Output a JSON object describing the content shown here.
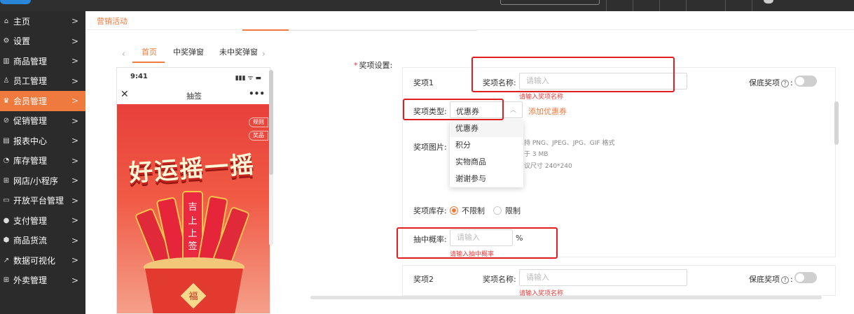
{
  "breadcrumb": "营销活动",
  "sidebar": {
    "items": [
      {
        "icon": "⌂",
        "icon_name": "home-icon",
        "label": "主页"
      },
      {
        "icon": "⚙",
        "icon_name": "settings-icon",
        "label": "设置"
      },
      {
        "icon": "▥",
        "icon_name": "barcode-icon",
        "label": "商品管理"
      },
      {
        "icon": "♙",
        "icon_name": "staff-icon",
        "label": "员工管理"
      },
      {
        "icon": "♛",
        "icon_name": "member-icon",
        "label": "会员管理"
      },
      {
        "icon": "⊘",
        "icon_name": "promotion-icon",
        "label": "促销管理"
      },
      {
        "icon": "▤",
        "icon_name": "report-icon",
        "label": "报表中心"
      },
      {
        "icon": "◔",
        "icon_name": "inventory-icon",
        "label": "库存管理"
      },
      {
        "icon": "⊞",
        "icon_name": "store-icon",
        "label": "网店/小程序"
      },
      {
        "icon": "▭",
        "icon_name": "platform-icon",
        "label": "开放平台管理"
      },
      {
        "icon": "●",
        "icon_name": "payment-icon",
        "label": "支付管理"
      },
      {
        "icon": "⬢",
        "icon_name": "goods-flow-icon",
        "label": "商品货流"
      },
      {
        "icon": "↗",
        "icon_name": "data-viz-icon",
        "label": "数据可视化"
      },
      {
        "icon": "⊞",
        "icon_name": "takeout-icon",
        "label": "外卖管理"
      }
    ],
    "active_index": 4,
    "arrow": ">"
  },
  "preview": {
    "tabs": [
      "首页",
      "中奖弹窗",
      "未中奖弹窗"
    ],
    "active_tab": 0,
    "prev": "‹",
    "next": "›",
    "phone": {
      "time": "9:41",
      "status": "▮▮▮ ᯤ ▬",
      "close": "✕",
      "title": "抽签",
      "more": "•••",
      "btn_rules": "规则",
      "btn_prizes": "奖品",
      "banner": "好运摇一摇",
      "stick_text": [
        "吉",
        "上上签"
      ],
      "bucket_text": "福"
    }
  },
  "form": {
    "section_label": "奖项设置:",
    "required_mark": "*",
    "prize1": {
      "title": "奖项1",
      "name_label": "奖项名称:",
      "name_placeholder": "请输入",
      "name_error": "请输入奖项名称",
      "guarantee_label": "保底奖项",
      "help_icon": "?",
      "type_label": "奖项类型:",
      "type_value": "优惠券",
      "type_chevron": "︿",
      "add_link": "添加优惠券",
      "type_options": [
        "优惠券",
        "积分",
        "实物商品",
        "谢谢参与"
      ],
      "image_label": "奖项图片:",
      "image_hints": [
        "持 PNG、JPEG、JPG、GIF 格式",
        "于 3 MB",
        "议尺寸 240*240"
      ],
      "stock_label": "奖项库存:",
      "stock_options": [
        "不限制",
        "限制"
      ],
      "stock_selected": 0,
      "prob_label": "抽中概率:",
      "prob_placeholder": "请输入",
      "prob_unit": "%",
      "prob_error": "请输入抽中概率"
    },
    "prize2": {
      "title": "奖项2",
      "name_label": "奖项名称:",
      "name_placeholder": "请输入",
      "name_error": "请输入奖项名称",
      "guarantee_label": "保底奖项",
      "help_icon": "?"
    }
  },
  "colors": {
    "accent": "#ef7a3d",
    "sidebar_bg": "#2b2b2b",
    "error": "#e6393a",
    "highlight_box": "#e02020"
  }
}
